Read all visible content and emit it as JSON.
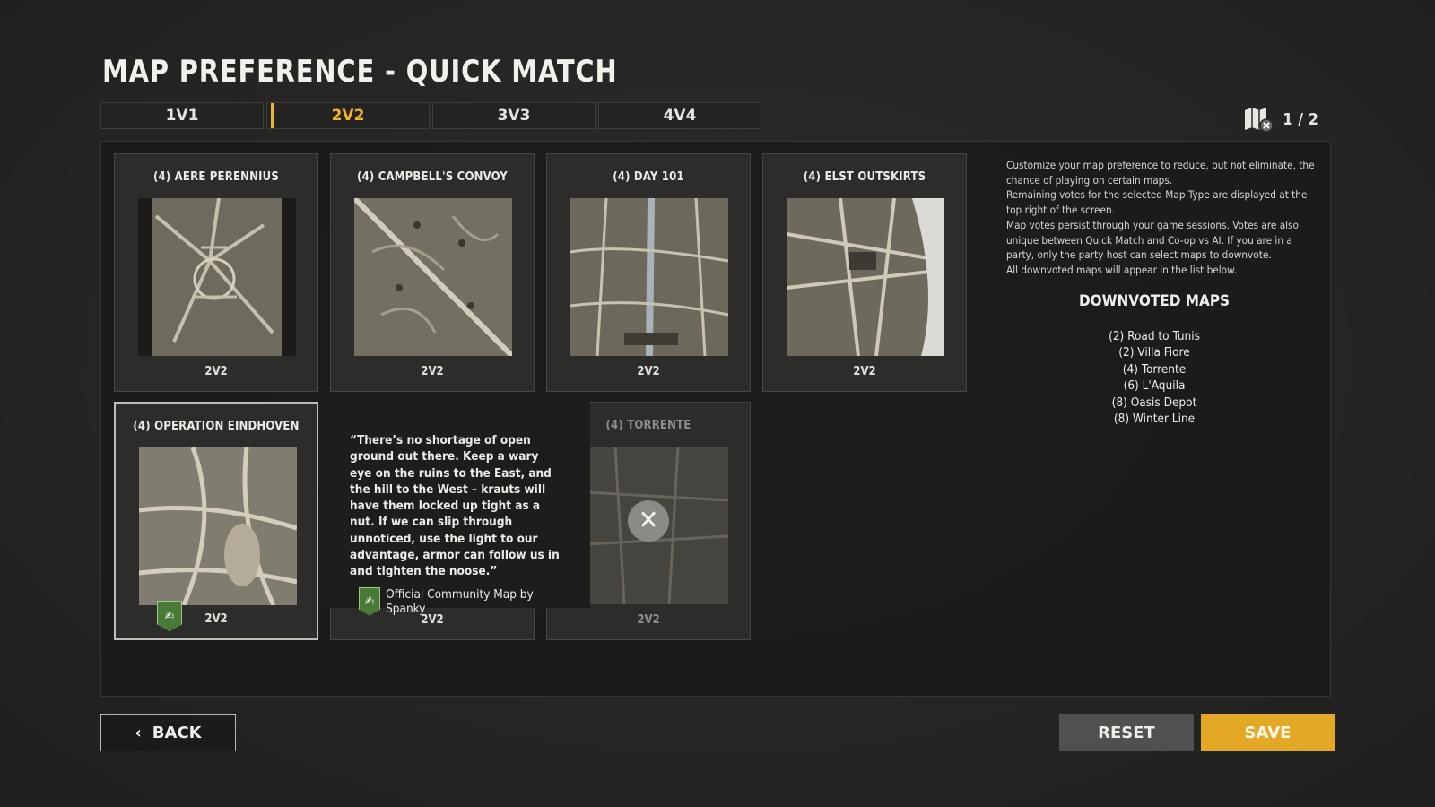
{
  "page": {
    "title": "MAP PREFERENCE - QUICK MATCH"
  },
  "tabs": [
    {
      "label": "1V1",
      "active": false
    },
    {
      "label": "2V2",
      "active": true
    },
    {
      "label": "3V3",
      "active": false
    },
    {
      "label": "4V4",
      "active": false
    }
  ],
  "votes": {
    "counter": "1 / 2",
    "icon": "map-downvote-icon"
  },
  "maps": [
    {
      "name": "(4) AERE PERENNIUS",
      "mode": "2V2"
    },
    {
      "name": "(4) CAMPBELL'S CONVOY",
      "mode": "2V2"
    },
    {
      "name": "(4) DAY 101",
      "mode": "2V2"
    },
    {
      "name": "(4) ELST OUTSKIRTS",
      "mode": "2V2"
    },
    {
      "name": "(4) OPERATION EINDHOVEN",
      "mode": "2V2",
      "selected": true,
      "community": true
    },
    {
      "name": "",
      "mode": "2V2"
    },
    {
      "name": "(4) TORRENTE",
      "mode": "2V2",
      "downvoted": true
    }
  ],
  "tooltip": {
    "quote": "“There’s no shortage of open ground out there. Keep a wary eye on the ruins to the East, and the hill to the West – krauts will have them locked up tight as a nut. If we can slip through unnoticed, use the light to our advantage, armor can follow us in and tighten the noose.”",
    "credit": "Official Community Map by Spanky"
  },
  "info": {
    "lines": [
      "Customize your map preference to reduce, but not eliminate, the chance of playing on certain maps.",
      "Remaining votes for the selected Map Type are displayed at the top right of the screen.",
      "Map votes persist through your game sessions. Votes are also unique between Quick Match and Co-op vs AI. If you are in a party, only the party host can select maps to downvote.",
      "All downvoted maps will appear in the list below."
    ]
  },
  "downvoted": {
    "title": "DOWNVOTED MAPS",
    "items": [
      "(2) Road to Tunis",
      "(2) Villa Fiore",
      "(4) Torrente",
      "(6) L'Aquila",
      "(8) Oasis Depot",
      "(8) Winter Line"
    ]
  },
  "buttons": {
    "back": "BACK",
    "reset": "RESET",
    "save": "SAVE"
  },
  "colors": {
    "accent": "#f0b32a",
    "save": "#e2a826",
    "community": "#4a7a38"
  }
}
